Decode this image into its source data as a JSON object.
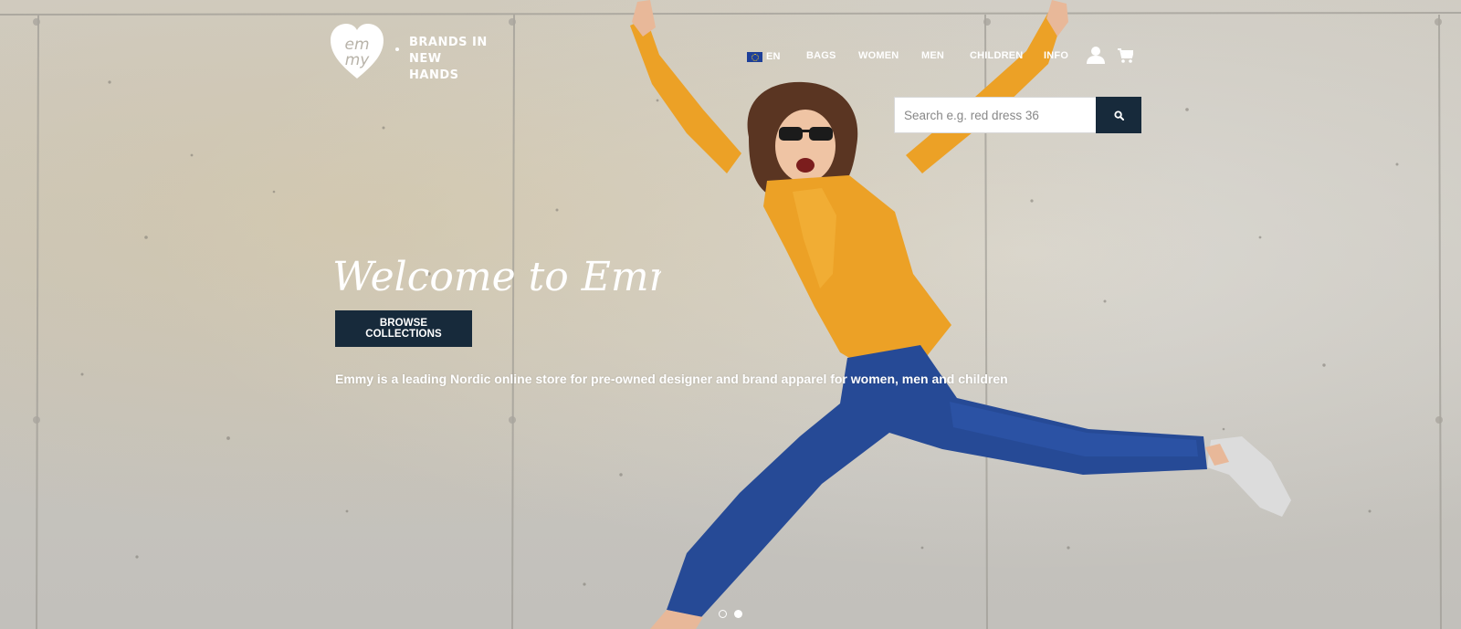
{
  "brand": {
    "logo_text_top": "em",
    "logo_text_bottom": "my",
    "tagline_line1": "BRANDS IN",
    "tagline_line2": "NEW HANDS"
  },
  "nav": {
    "language": "EN",
    "items": [
      "BAGS",
      "WOMEN",
      "MEN",
      "CHILDREN",
      "INFO"
    ]
  },
  "icons": {
    "flag": "eu-flag-icon",
    "account": "user-icon",
    "cart": "cart-icon",
    "search": "search-icon"
  },
  "search": {
    "placeholder": "Search e.g. red dress 36",
    "value": ""
  },
  "hero": {
    "headline": "Welcome to Emmy!",
    "cta_label": "BROWSE COLLECTIONS",
    "description": "Emmy is a leading Nordic online store for pre-owned designer and brand apparel for women, men and children"
  },
  "carousel": {
    "slide_count": 2,
    "active_index": 1
  },
  "colors": {
    "primary_dark": "#172a3b",
    "text_light": "#ffffff",
    "shirt_orange": "#eca126",
    "jeans_blue": "#264a96"
  }
}
